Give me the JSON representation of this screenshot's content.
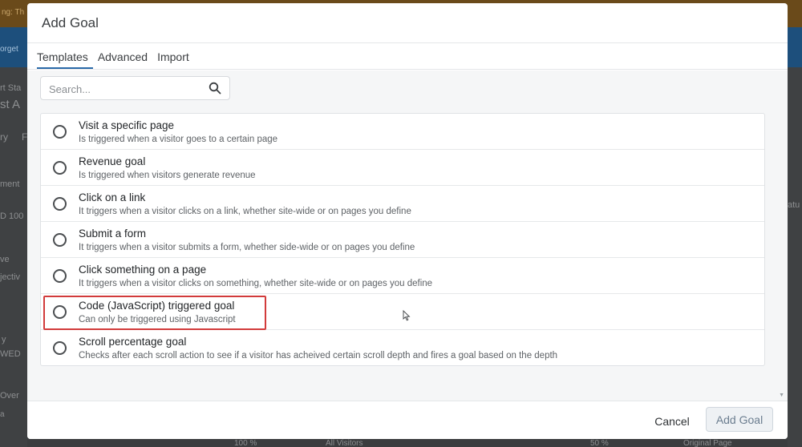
{
  "background": {
    "topbar_text": "ng: Th",
    "navbar_text": "orget",
    "left_fragments": [
      "rt Sta",
      "st A",
      "ry",
      "F",
      "ment",
      "D 100",
      "ve",
      "jectiv",
      "y",
      "WED",
      "Over",
      "a"
    ],
    "right_fragments": [
      "atu"
    ],
    "bottom_fragments": [
      "100 %",
      "All Visitors",
      "50 %",
      "Original Page"
    ]
  },
  "modal": {
    "title": "Add Goal",
    "tabs": [
      {
        "label": "Templates",
        "active": true
      },
      {
        "label": "Advanced",
        "active": false
      },
      {
        "label": "Import",
        "active": false
      }
    ],
    "search": {
      "placeholder": "Search..."
    },
    "goals": [
      {
        "title": "Visit a specific page",
        "description": "Is triggered when a visitor goes to a certain page"
      },
      {
        "title": "Revenue goal",
        "description": "Is triggered when visitors generate revenue"
      },
      {
        "title": "Click on a link",
        "description": "It triggers when a visitor clicks on a link, whether site-wide or on pages you define"
      },
      {
        "title": "Submit a form",
        "description": "It triggers when a visitor submits a form, whether side-wide or on pages you define"
      },
      {
        "title": "Click something on a page",
        "description": "It triggers when a visitor clicks on something, whether site-wide or on pages you define"
      },
      {
        "title": "Code (JavaScript) triggered goal",
        "description": "Can only be triggered using Javascript",
        "highlighted": true
      },
      {
        "title": "Scroll percentage goal",
        "description": "Checks after each scroll action to see if a visitor has acheived certain scroll depth and fires a goal based on the depth"
      }
    ],
    "footer": {
      "cancel_label": "Cancel",
      "add_label": "Add Goal"
    }
  },
  "colors": {
    "highlight": "#d23b3b",
    "tab_underline": "#2a6aa8",
    "navbar": "#1d4f7c"
  }
}
